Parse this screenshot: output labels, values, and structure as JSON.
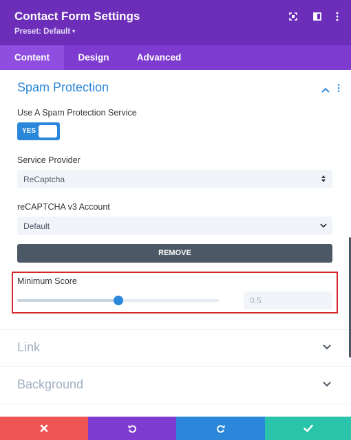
{
  "header": {
    "title": "Contact Form Settings",
    "preset_label": "Preset: Default",
    "preset_caret": "▾",
    "bg_color": "#6c2eb9",
    "icons": [
      "fullscreen-icon",
      "sidebar-layout-icon",
      "more-options-icon"
    ]
  },
  "tabs": [
    {
      "label": "Content",
      "active": true
    },
    {
      "label": "Design",
      "active": false
    },
    {
      "label": "Advanced",
      "active": false
    }
  ],
  "spam_section": {
    "title": "Spam Protection",
    "expanded": true,
    "use_service": {
      "label": "Use A Spam Protection Service",
      "toggle_text": "YES",
      "on": true
    },
    "provider": {
      "label": "Service Provider",
      "value": "ReCaptcha"
    },
    "account": {
      "label": "reCAPTCHA v3 Account",
      "value": "Default"
    },
    "remove_label": "REMOVE",
    "min_score": {
      "label": "Minimum Score",
      "value": "0.5",
      "fraction": 0.5
    }
  },
  "collapsed_sections": [
    {
      "title": "Link"
    },
    {
      "title": "Background"
    }
  ],
  "footer": [
    {
      "action": "discard",
      "icon": "close-icon",
      "color": "#ef5555"
    },
    {
      "action": "undo",
      "icon": "undo-icon",
      "color": "#7e3bd0"
    },
    {
      "action": "redo",
      "icon": "redo-icon",
      "color": "#2b87da"
    },
    {
      "action": "save",
      "icon": "check-icon",
      "color": "#29c4a9"
    }
  ],
  "colors": {
    "accent": "#2b87da",
    "highlight_border": "#d3272c",
    "dark_button": "#4c5866"
  }
}
